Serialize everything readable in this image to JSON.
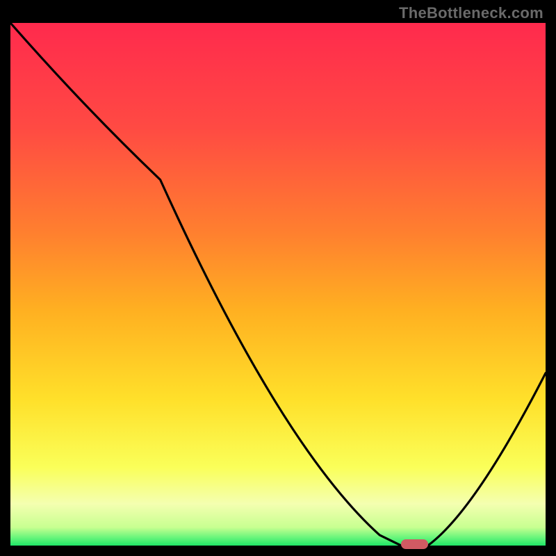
{
  "watermark": "TheBottleneck.com",
  "colors": {
    "gradient": [
      {
        "offset": 0.0,
        "hex": "#ff2a4d"
      },
      {
        "offset": 0.2,
        "hex": "#ff4a43"
      },
      {
        "offset": 0.4,
        "hex": "#ff7f2f"
      },
      {
        "offset": 0.55,
        "hex": "#ffb021"
      },
      {
        "offset": 0.72,
        "hex": "#ffe02a"
      },
      {
        "offset": 0.85,
        "hex": "#faff59"
      },
      {
        "offset": 0.92,
        "hex": "#f4ffb0"
      },
      {
        "offset": 0.965,
        "hex": "#c8ff91"
      },
      {
        "offset": 0.985,
        "hex": "#66f57b"
      },
      {
        "offset": 1.0,
        "hex": "#1fe667"
      }
    ],
    "curve": "#000000",
    "marker": "#d15a63",
    "frame_border": "#000000"
  },
  "chart_data": {
    "type": "line",
    "title": "",
    "xlabel": "",
    "ylabel": "",
    "xlim": [
      0,
      100
    ],
    "ylim": [
      0,
      100
    ],
    "x": [
      0,
      28,
      69,
      73,
      78,
      100
    ],
    "values": [
      100,
      70,
      2,
      0,
      0,
      33
    ],
    "marker": {
      "x": 75.5,
      "y": 0,
      "width_pct": 5.0
    },
    "grid": false,
    "legend": false
  }
}
